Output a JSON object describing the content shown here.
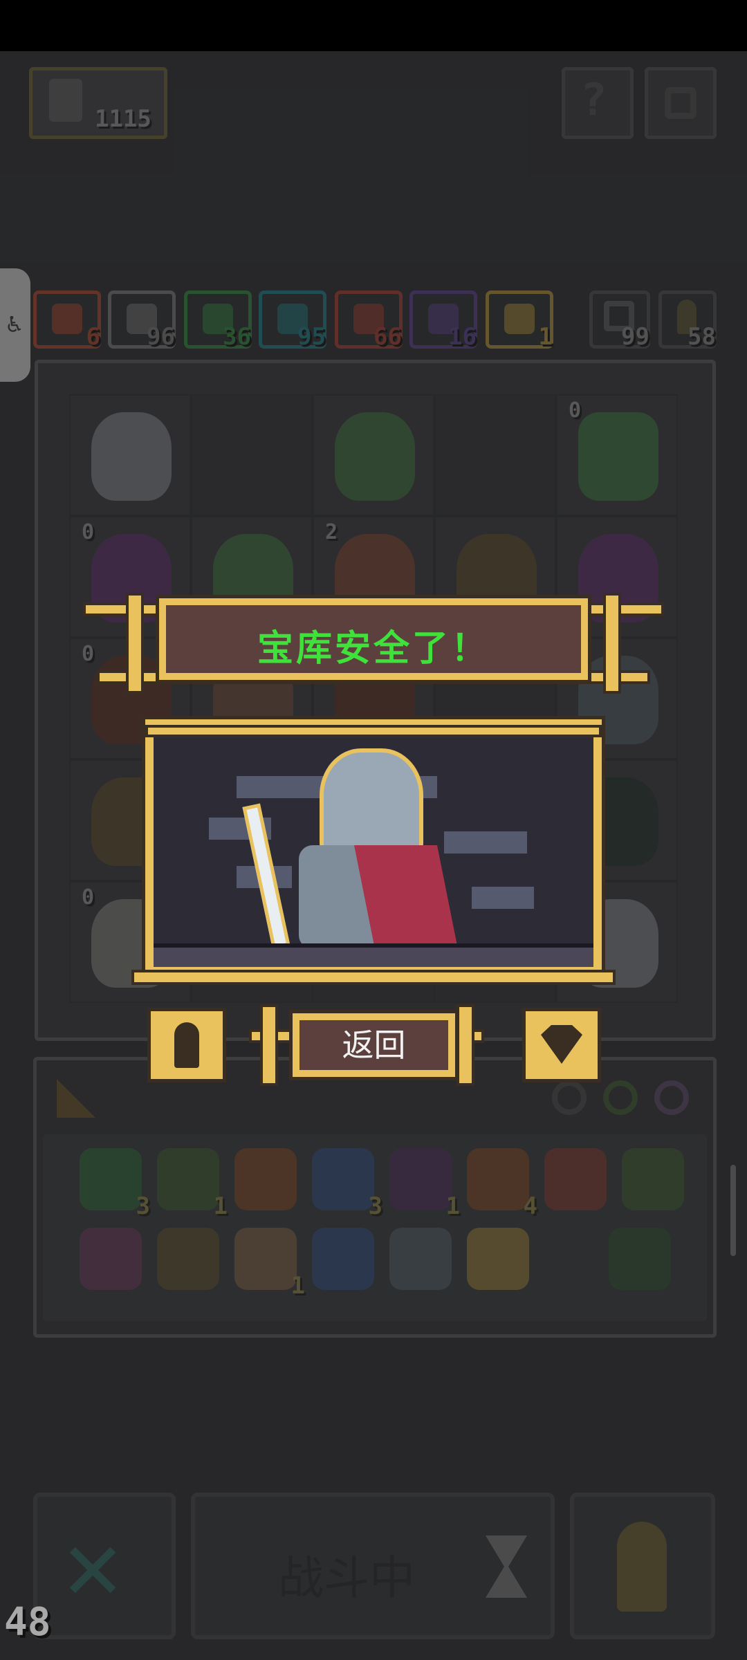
{
  "hud": {
    "coins": "1115",
    "help_icon": "question-icon",
    "settings_icon": "gear-icon"
  },
  "resources": [
    {
      "name": "orange-cross",
      "value": "6",
      "color": "#c0563b"
    },
    {
      "name": "grey-wing",
      "value": "96",
      "color": "#8a8a8a"
    },
    {
      "name": "green-drop",
      "value": "36",
      "color": "#3f9a4c"
    },
    {
      "name": "cyan-spiral",
      "value": "95",
      "color": "#2c8f96"
    },
    {
      "name": "red-cross",
      "value": "66",
      "color": "#b84c3d"
    },
    {
      "name": "purple-bolt",
      "value": "16",
      "color": "#6b4f9e"
    },
    {
      "name": "gold-arrow",
      "value": "1",
      "color": "#c4a246"
    }
  ],
  "counters": [
    {
      "name": "return-arrow",
      "value": "99"
    },
    {
      "name": "pawn",
      "value": "58"
    }
  ],
  "grid_badges": [
    "0",
    "0",
    "2",
    "0",
    "0"
  ],
  "items": [
    {
      "icon": "emerald-shield-icon",
      "count": "3"
    },
    {
      "icon": "goblin-item-icon",
      "count": "1"
    },
    {
      "icon": "copper-armor-icon",
      "count": ""
    },
    {
      "icon": "hourglass-icon",
      "count": "3"
    },
    {
      "icon": "jar-icon",
      "count": "1"
    },
    {
      "icon": "orb-icon",
      "count": "4"
    },
    {
      "icon": "arrow-icon",
      "count": ""
    },
    {
      "icon": "potion-icon",
      "count": ""
    },
    {
      "icon": "purple-arrow-icon",
      "count": ""
    },
    {
      "icon": "chest-icon",
      "count": ""
    },
    {
      "icon": "eye-hand-icon",
      "count": "1"
    },
    {
      "icon": "water-drop-icon",
      "count": ""
    },
    {
      "icon": "lever-icon",
      "count": ""
    },
    {
      "icon": "goblet-icon",
      "count": ""
    },
    {
      "icon": "map-icon",
      "count": ""
    }
  ],
  "popup": {
    "title": "宝库安全了！",
    "return_label": "返回",
    "left_icon": "keyhole-icon",
    "right_icon": "heart-gem-icon"
  },
  "footer": {
    "battle_label": "战斗中",
    "fps": "48"
  }
}
